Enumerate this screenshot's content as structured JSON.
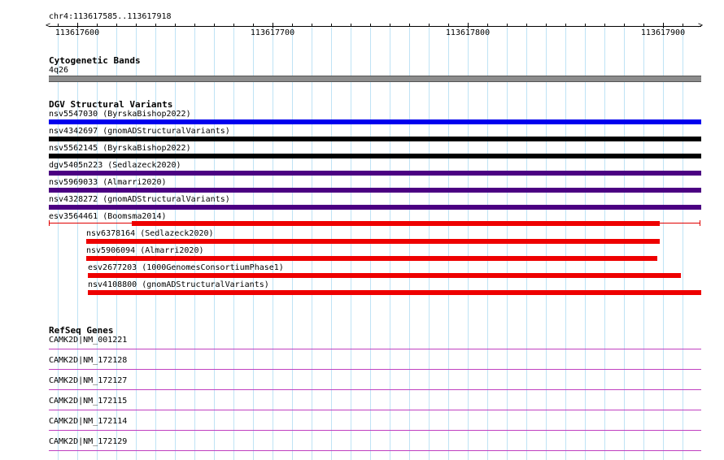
{
  "location": "chr4:113617585..113617918",
  "ruler": {
    "ticks": [
      "113617600",
      "113617700",
      "113617800",
      "113617900"
    ]
  },
  "cytoband": {
    "title": "Cytogenetic Bands",
    "band": "4q26",
    "color": "#8c8c8c"
  },
  "dgv": {
    "title": "DGV Structural Variants",
    "items": [
      {
        "label": "nsv5547030 (ByrskaBishop2022)",
        "color": "#0000ee"
      },
      {
        "label": "nsv4342697 (gnomADStructuralVariants)",
        "color": "#000000"
      },
      {
        "label": "nsv5562145 (ByrskaBishop2022)",
        "color": "#000000"
      },
      {
        "label": "dgv5405n223 (Sedlazeck2020)",
        "color": "#4b0082"
      },
      {
        "label": "nsv5969033 (Almarri2020)",
        "color": "#4b0082"
      },
      {
        "label": "nsv4328272 (gnomADStructuralVariants)",
        "color": "#4b0082"
      },
      {
        "label": "esv3564461 (Boomsma2014)",
        "color": "#ee0000"
      },
      {
        "label": "nsv6378164 (Sedlazeck2020)",
        "color": "#ee0000"
      },
      {
        "label": "nsv5906094 (Almarri2020)",
        "color": "#ee0000"
      },
      {
        "label": "esv2677203 (1000GenomesConsortiumPhase1)",
        "color": "#ee0000"
      },
      {
        "label": "nsv4108800 (gnomADStructuralVariants)",
        "color": "#ee0000"
      }
    ]
  },
  "refseq": {
    "title": "RefSeq Genes",
    "color": "#c040c0",
    "items": [
      {
        "label": "CAMK2D|NM_001221"
      },
      {
        "label": "CAMK2D|NM_172128"
      },
      {
        "label": "CAMK2D|NM_172127"
      },
      {
        "label": "CAMK2D|NM_172115"
      },
      {
        "label": "CAMK2D|NM_172114"
      },
      {
        "label": "CAMK2D|NM_172129"
      }
    ]
  }
}
